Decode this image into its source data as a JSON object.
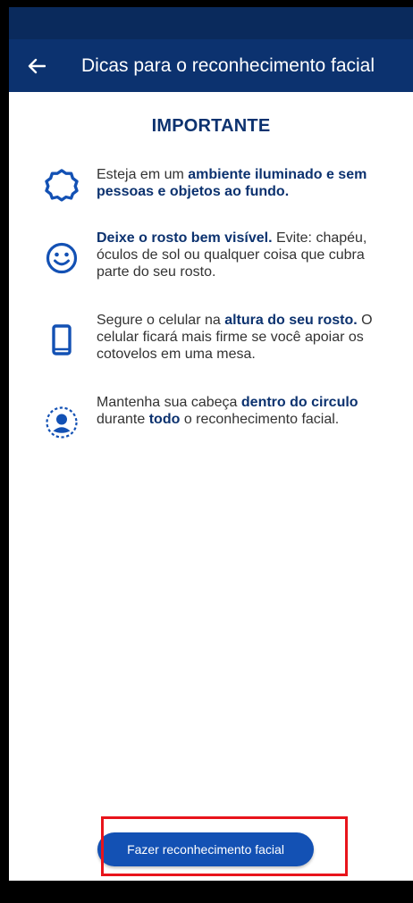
{
  "app_bar": {
    "title": "Dicas para o reconhecimento facial"
  },
  "heading": "IMPORTANTE",
  "tips": [
    {
      "icon": "sun-icon",
      "segments": [
        {
          "text": "Esteja em um ",
          "bold": false
        },
        {
          "text": "ambiente iluminado e sem pessoas e objetos ao fundo.",
          "bold": true
        }
      ]
    },
    {
      "icon": "smiley-face-icon",
      "segments": [
        {
          "text": "Deixe o rosto bem visível.",
          "bold": true
        },
        {
          "text": " Evite: chapéu, óculos de sol ou qualquer coisa que cubra parte do seu rosto.",
          "bold": false
        }
      ]
    },
    {
      "icon": "smartphone-icon",
      "segments": [
        {
          "text": "Segure o celular na ",
          "bold": false
        },
        {
          "text": "altura do seu rosto.",
          "bold": true
        },
        {
          "text": " O celular ficará mais firme se você apoiar os cotovelos em uma mesa.",
          "bold": false
        }
      ]
    },
    {
      "icon": "face-in-circle-icon",
      "segments": [
        {
          "text": "Mantenha sua cabeça ",
          "bold": false
        },
        {
          "text": "dentro do circulo",
          "bold": true
        },
        {
          "text": " durante ",
          "bold": false
        },
        {
          "text": "todo",
          "bold": true
        },
        {
          "text": " o reconhecimento facial.",
          "bold": false
        }
      ]
    }
  ],
  "cta": {
    "label": "Fazer reconhecimento facial"
  },
  "colors": {
    "primary_dark": "#0c326f",
    "primary": "#1351b4",
    "highlight": "#e8141b"
  }
}
